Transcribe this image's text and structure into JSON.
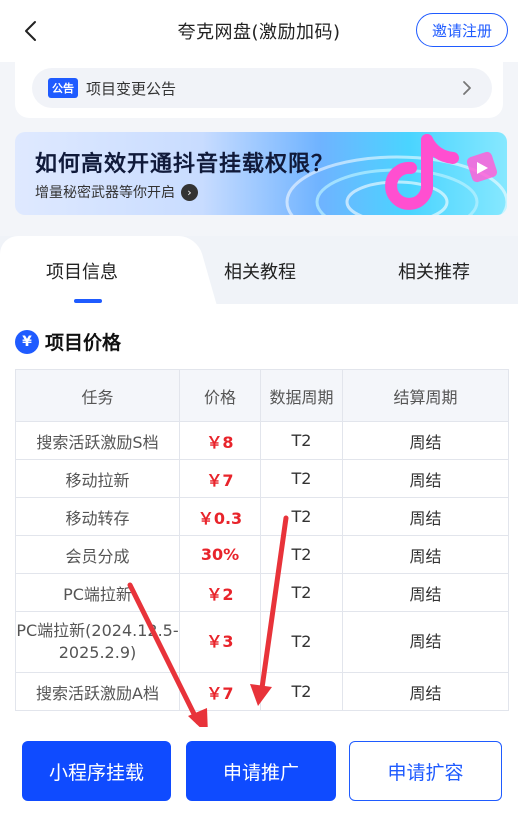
{
  "header": {
    "title": "夸克网盘(激励加码)",
    "invite_label": "邀请注册"
  },
  "notice": {
    "tag": "公告",
    "text": "项目变更公告"
  },
  "banner": {
    "title": "如何高效开通抖音挂载权限？",
    "subtitle": "增量秘密武器等你开启"
  },
  "tabs": [
    "项目信息",
    "相关教程",
    "相关推荐"
  ],
  "section": {
    "icon": "yen-icon",
    "title": "项目价格"
  },
  "table": {
    "headers": [
      "任务",
      "价格",
      "数据周期",
      "结算周期"
    ],
    "rows": [
      {
        "task": "搜索活跃激励S档",
        "price": "￥8",
        "data_cycle": "T2",
        "settle": "周结"
      },
      {
        "task": "移动拉新",
        "price": "￥7",
        "data_cycle": "T2",
        "settle": "周结"
      },
      {
        "task": "移动转存",
        "price": "￥0.3",
        "data_cycle": "T2",
        "settle": "周结"
      },
      {
        "task": "会员分成",
        "price": "30%",
        "data_cycle": "T2",
        "settle": "周结"
      },
      {
        "task": "PC端拉新",
        "price": "￥2",
        "data_cycle": "T2",
        "settle": "周结"
      },
      {
        "task": "PC端拉新(2024.12.5-2025.2.9)",
        "price": "￥3",
        "data_cycle": "T2",
        "settle": "周结"
      },
      {
        "task": "搜索活跃激励A档",
        "price": "￥7",
        "data_cycle": "T2",
        "settle": "周结"
      }
    ]
  },
  "buttons": {
    "mini_program": "小程序挂载",
    "apply": "申请推广",
    "expand": "申请扩容"
  },
  "colors": {
    "accent": "#1f5bff",
    "price_red": "#e8242b",
    "annotation_red": "#e8333a"
  }
}
